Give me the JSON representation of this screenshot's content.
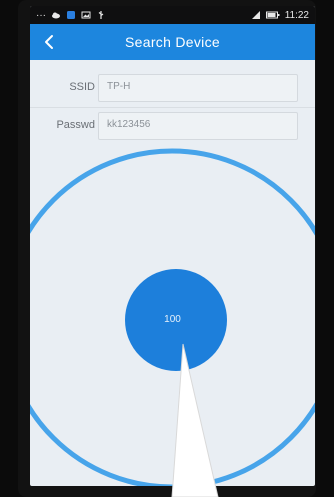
{
  "status_bar": {
    "time": "11:22",
    "icons": [
      "more-dots-icon",
      "cloud-icon",
      "app-icon",
      "image-icon",
      "usb-icon",
      "signal-icon",
      "battery-icon"
    ]
  },
  "header": {
    "title": "Search Device",
    "back_icon": "chevron-left-icon"
  },
  "form": {
    "ssid": {
      "label": "SSID",
      "value": "TP-H"
    },
    "password": {
      "label": "Passwd",
      "value": "kk123456"
    }
  },
  "radar": {
    "center_value": "100",
    "accent_color": "#1d86de",
    "ring_color": "#2a96e8"
  }
}
